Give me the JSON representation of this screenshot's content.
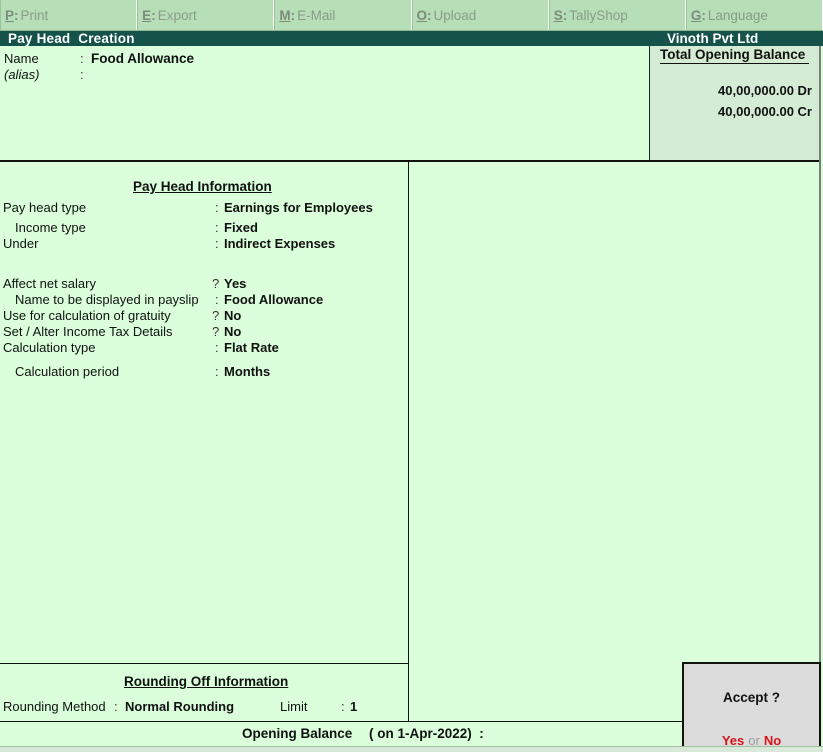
{
  "toolbar": {
    "buttons": [
      {
        "key": "P",
        "label": "Print"
      },
      {
        "key": "E",
        "label": "Export"
      },
      {
        "key": "M",
        "label": "E-Mail"
      },
      {
        "key": "O",
        "label": "Upload"
      },
      {
        "key": "S",
        "label": "TallyShop"
      },
      {
        "key": "G",
        "label": "Language"
      }
    ]
  },
  "titlebar": {
    "screen_title": "Pay Head  Creation",
    "company": "Vinoth Pvt Ltd"
  },
  "header": {
    "name_label": "Name",
    "name_value": "Food Allowance",
    "alias_label": "(alias)",
    "alias_value": ""
  },
  "balance": {
    "title": "Total Opening Balance",
    "debit": "40,00,000.00 Dr",
    "credit": "40,00,000.00 Cr"
  },
  "pay_head_info": {
    "title": "Pay Head Information",
    "fields": [
      {
        "label": "Pay head type",
        "sep": ":",
        "value": "Earnings for Employees"
      },
      {
        "label": "Income type",
        "sep": ":",
        "value": "Fixed"
      },
      {
        "label": "Under",
        "sep": ":",
        "value": "Indirect Expenses"
      },
      {
        "label": "Affect net salary",
        "sep": "?",
        "value": "Yes"
      },
      {
        "label": "Name to be displayed in payslip",
        "sep": ":",
        "value": "Food Allowance"
      },
      {
        "label": "Use for calculation of gratuity",
        "sep": "?",
        "value": "No"
      },
      {
        "label": "Set / Alter Income Tax Details",
        "sep": "?",
        "value": "No"
      },
      {
        "label": "Calculation type",
        "sep": ":",
        "value": "Flat Rate"
      },
      {
        "label": "Calculation period",
        "sep": ":",
        "value": "Months"
      }
    ]
  },
  "rounding": {
    "title": "Rounding Off Information",
    "method_label": "Rounding Method",
    "method_value": "Normal Rounding",
    "limit_label": "Limit",
    "limit_value": "1"
  },
  "opening_balance": {
    "label": "Opening Balance",
    "date_text": "( on 1-Apr-2022)  :"
  },
  "accept_dialog": {
    "question": "Accept ?",
    "yes": "Yes",
    "or": "or",
    "no": "No"
  },
  "colors": {
    "background": "#daffda",
    "titlebar": "#14524a",
    "toolbar": "#b7dfb7",
    "accept_choice": "#d6141a"
  }
}
